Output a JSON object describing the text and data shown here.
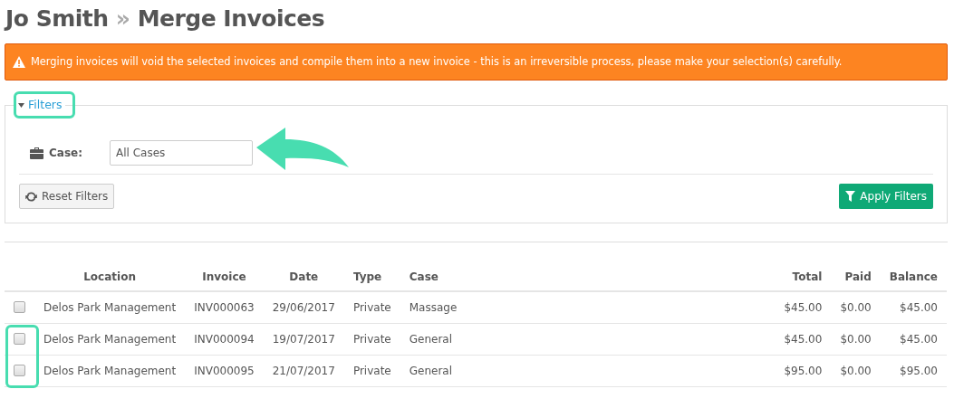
{
  "page_title": {
    "client": "Jo Smith",
    "separator": "»",
    "title": "Merge Invoices"
  },
  "alert": {
    "text": "Merging invoices will void the selected invoices and compile them into a new invoice - this is an irreversible process, please make your selection(s) carefully."
  },
  "filters": {
    "legend": "Filters",
    "expanded": true,
    "case_label": "Case:",
    "case_value": "All Cases",
    "reset_button": "Reset Filters",
    "apply_button": "Apply Filters"
  },
  "table": {
    "columns": [
      "Location",
      "Invoice",
      "Date",
      "Type",
      "Case",
      "Total",
      "Paid",
      "Balance"
    ],
    "rows": [
      {
        "checked": false,
        "cells": [
          "Delos Park Management",
          "INV000063",
          "29/06/2017",
          "Private",
          "Massage",
          "$45.00",
          "$0.00",
          "$45.00"
        ]
      },
      {
        "checked": false,
        "cells": [
          "Delos Park Management",
          "INV000094",
          "19/07/2017",
          "Private",
          "General",
          "$45.00",
          "$0.00",
          "$45.00"
        ]
      },
      {
        "checked": false,
        "cells": [
          "Delos Park Management",
          "INV000095",
          "21/07/2017",
          "Private",
          "General",
          "$95.00",
          "$0.00",
          "$95.00"
        ]
      }
    ]
  }
}
